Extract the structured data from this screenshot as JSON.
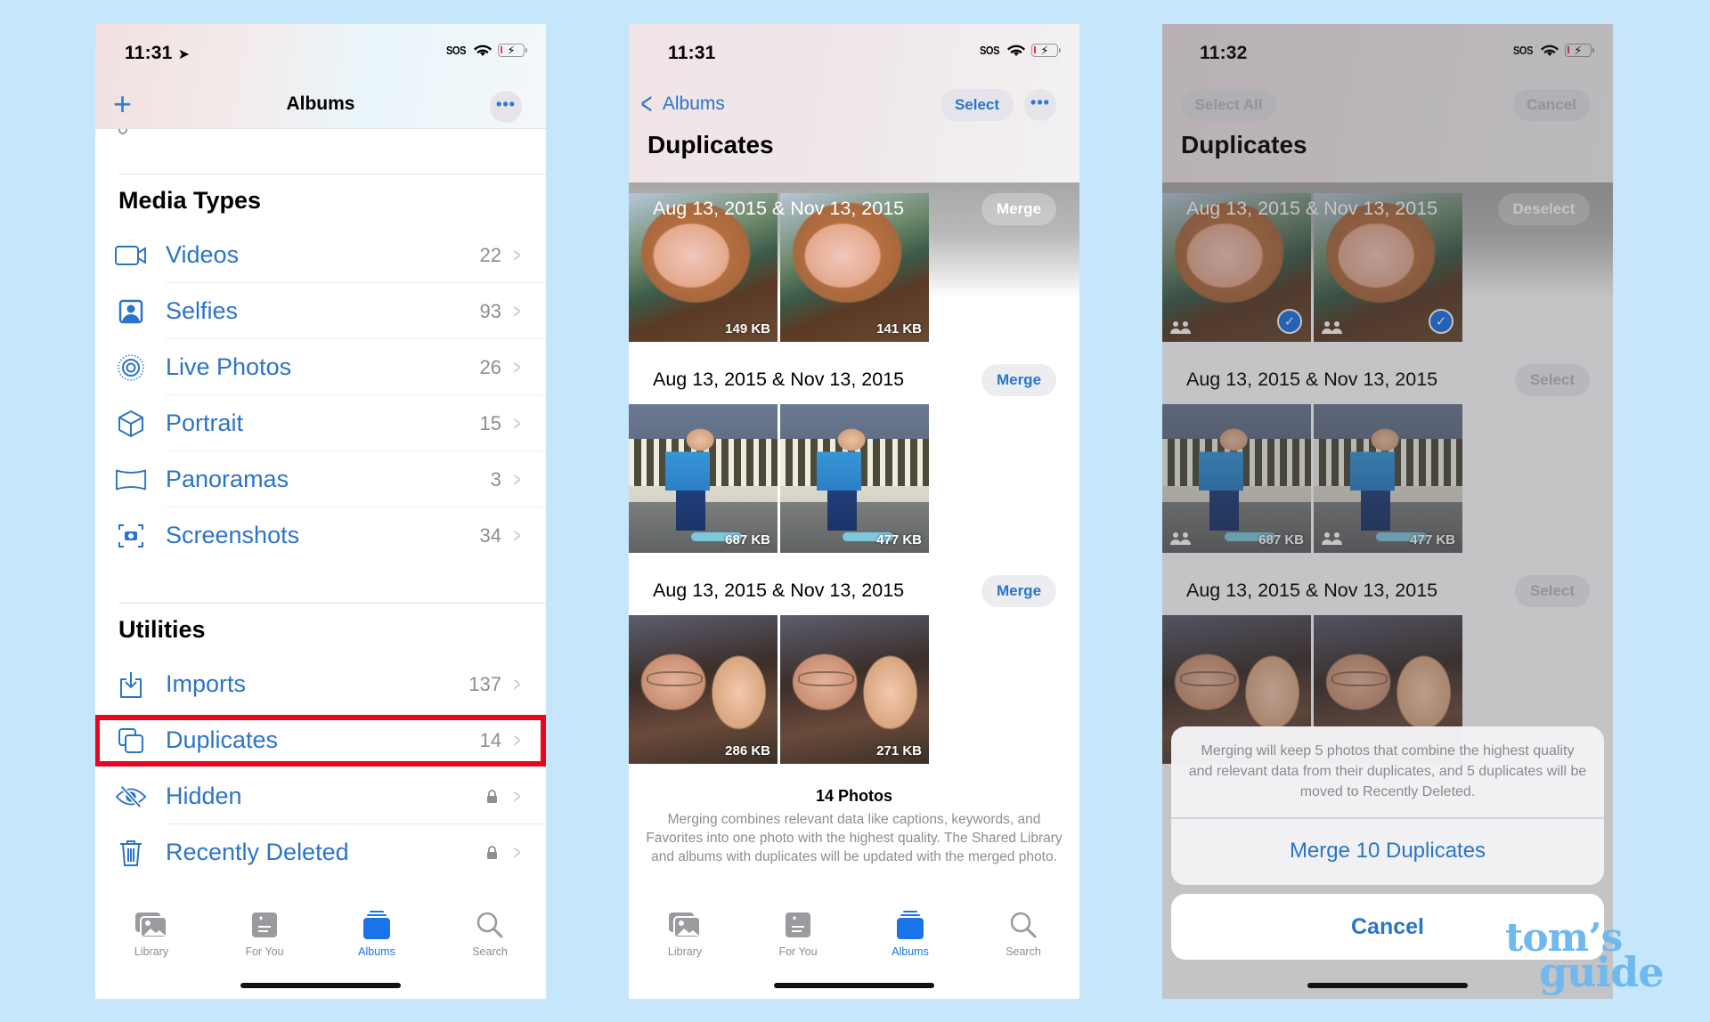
{
  "colors": {
    "background": "#c5e6fb",
    "accent": "#2b74c9",
    "tab_active": "#1a73e8",
    "highlight_box": "#e8071e",
    "secondary_text": "#8e8e93",
    "watermark": "#6fb9ee"
  },
  "status_icons": {
    "signal_label": "SOS",
    "wifi": "wifi-icon",
    "battery": "battery-charging-icon"
  },
  "tabbar": {
    "items": [
      {
        "label": "Library",
        "icon": "library-icon"
      },
      {
        "label": "For You",
        "icon": "for-you-icon"
      },
      {
        "label": "Albums",
        "icon": "albums-icon",
        "active": true
      },
      {
        "label": "Search",
        "icon": "search-icon"
      }
    ]
  },
  "screen1": {
    "time": "11:31",
    "location_icon": "location-arrow-icon",
    "nav_title": "Albums",
    "add_icon": "plus-icon",
    "more_icon": "ellipsis-icon",
    "media_types": {
      "title": "Media Types",
      "items": [
        {
          "label": "Videos",
          "count": "22",
          "icon": "video-icon"
        },
        {
          "label": "Selfies",
          "count": "93",
          "icon": "selfie-icon"
        },
        {
          "label": "Live Photos",
          "count": "26",
          "icon": "live-photo-icon"
        },
        {
          "label": "Portrait",
          "count": "15",
          "icon": "cube-icon"
        },
        {
          "label": "Panoramas",
          "count": "3",
          "icon": "panorama-icon"
        },
        {
          "label": "Screenshots",
          "count": "34",
          "icon": "screenshot-icon"
        }
      ]
    },
    "utilities": {
      "title": "Utilities",
      "items": [
        {
          "label": "Imports",
          "count": "137",
          "icon": "import-icon"
        },
        {
          "label": "Duplicates",
          "count": "14",
          "icon": "duplicate-icon",
          "highlighted": true
        },
        {
          "label": "Hidden",
          "locked": true,
          "icon": "eye-slash-icon"
        },
        {
          "label": "Recently Deleted",
          "locked": true,
          "icon": "trash-icon"
        }
      ]
    }
  },
  "screen2": {
    "time": "11:31",
    "back_label": "Albums",
    "select_label": "Select",
    "title": "Duplicates",
    "groups": [
      {
        "date": "Aug 13, 2015 & Nov 13, 2015",
        "action": "Merge",
        "photos": [
          {
            "size": "149 KB"
          },
          {
            "size": "141 KB"
          }
        ]
      },
      {
        "date": "Aug 13, 2015 & Nov 13, 2015",
        "action": "Merge",
        "photos": [
          {
            "size": "687 KB"
          },
          {
            "size": "477 KB"
          }
        ]
      },
      {
        "date": "Aug 13, 2015 & Nov 13, 2015",
        "action": "Merge",
        "photos": [
          {
            "size": "286 KB"
          },
          {
            "size": "271 KB"
          }
        ]
      }
    ],
    "summary_title": "14 Photos",
    "summary_text": "Merging combines relevant data like captions, keywords, and Favorites into one photo with the highest quality. The Shared Library and albums with duplicates will be updated with the merged photo."
  },
  "screen3": {
    "time": "11:32",
    "select_all_label": "Select All",
    "cancel_top_label": "Cancel",
    "title": "Duplicates",
    "groups": [
      {
        "date": "Aug 13, 2015 & Nov 13, 2015",
        "action": "Deselect",
        "selected": true,
        "photos": [
          {
            "size": ""
          },
          {
            "size": ""
          }
        ]
      },
      {
        "date": "Aug 13, 2015 & Nov 13, 2015",
        "action": "Select",
        "photos": [
          {
            "size": "687 KB"
          },
          {
            "size": "477 KB"
          }
        ]
      },
      {
        "date": "Aug 13, 2015 & Nov 13, 2015",
        "action": "Select",
        "photos": [
          {
            "size": ""
          },
          {
            "size": ""
          }
        ]
      }
    ],
    "sheet": {
      "message": "Merging will keep 5 photos that combine the highest quality and relevant data from their duplicates, and 5 duplicates will be moved to Recently Deleted.",
      "action_label": "Merge 10 Duplicates",
      "cancel_label": "Cancel"
    }
  },
  "watermark": {
    "line1": "tom’s",
    "line2": "guide"
  }
}
